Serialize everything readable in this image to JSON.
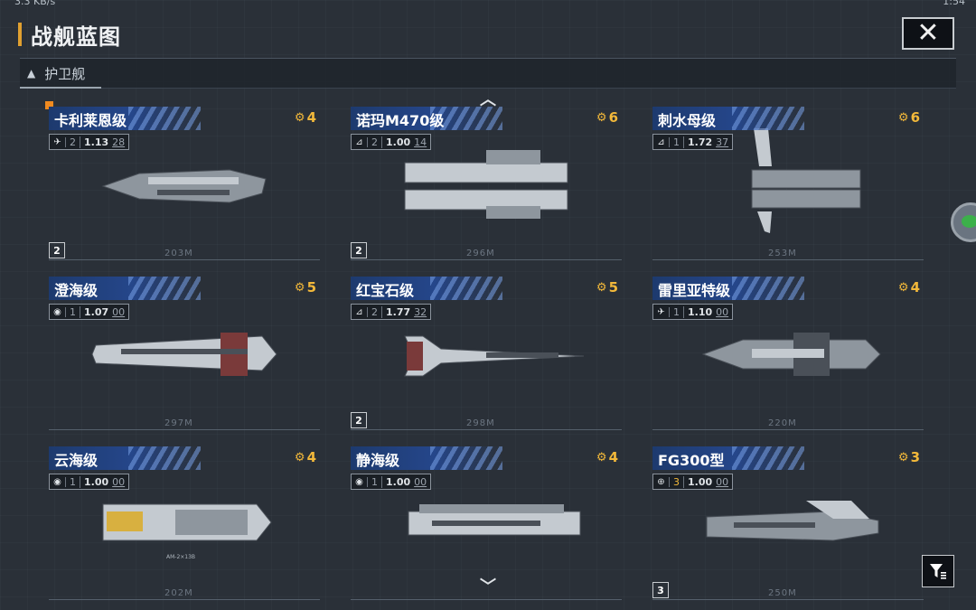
{
  "status_bar": {
    "left_text": "3.3 KB/s",
    "right_text": "1:54"
  },
  "header": {
    "title": "战舰蓝图",
    "close_label": "✕"
  },
  "section": {
    "label": "护卫舰",
    "collapse_icon": "▲"
  },
  "scroll": {
    "up_icon": "chevron-up",
    "down_icon": "chevron-down"
  },
  "colors": {
    "accent": "#e0a030",
    "cost": "#f2b83a",
    "name_bar": "#25468a"
  },
  "ships": [
    {
      "name": "卡利莱恩级",
      "cost": "4",
      "stat_icon": "fighter-icon",
      "level": "2",
      "value": "1.13",
      "sub": "28",
      "badge": "2",
      "length": "203M"
    },
    {
      "name": "诺玛M470级",
      "cost": "6",
      "stat_icon": "frigate-icon",
      "level": "2",
      "value": "1.00",
      "sub": "14",
      "badge": "2",
      "length": "296M"
    },
    {
      "name": "刺水母级",
      "cost": "6",
      "stat_icon": "frigate-icon",
      "level": "1",
      "value": "1.72",
      "sub": "37",
      "badge": "",
      "length": "253M"
    },
    {
      "name": "澄海级",
      "cost": "5",
      "stat_icon": "cannon-icon",
      "level": "1",
      "value": "1.07",
      "sub": "00",
      "badge": "",
      "length": "297M"
    },
    {
      "name": "红宝石级",
      "cost": "5",
      "stat_icon": "frigate-icon",
      "level": "2",
      "value": "1.77",
      "sub": "32",
      "badge": "2",
      "length": "298M"
    },
    {
      "name": "雷里亚特级",
      "cost": "4",
      "stat_icon": "fighter-icon",
      "level": "1",
      "value": "1.10",
      "sub": "00",
      "badge": "",
      "length": "220M"
    },
    {
      "name": "云海级",
      "cost": "4",
      "stat_icon": "cannon-icon",
      "level": "1",
      "value": "1.00",
      "sub": "00",
      "badge": "",
      "length": "202M"
    },
    {
      "name": "静海级",
      "cost": "4",
      "stat_icon": "cannon-icon",
      "level": "1",
      "value": "1.00",
      "sub": "00",
      "badge": "",
      "length": ""
    },
    {
      "name": "FG300型",
      "cost": "3",
      "stat_icon": "globe-icon",
      "level": "3",
      "value": "1.00",
      "sub": "00",
      "badge": "3",
      "length": "250M"
    }
  ]
}
